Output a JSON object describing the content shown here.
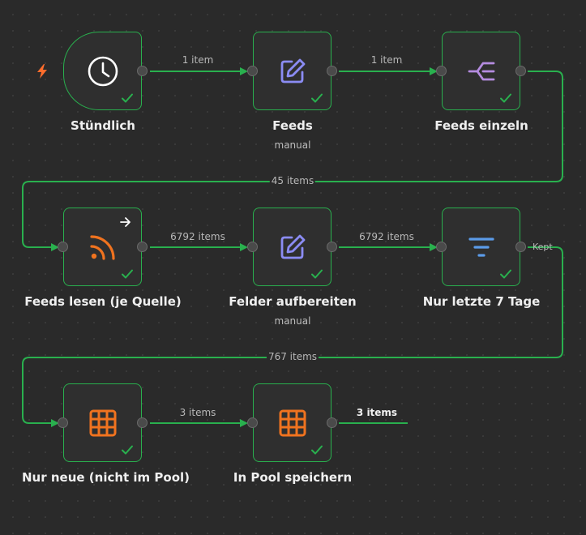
{
  "nodes": {
    "hourly": {
      "label": "Stündlich"
    },
    "feeds": {
      "label": "Feeds",
      "subtitle": "manual"
    },
    "feeds_single": {
      "label": "Feeds einzeln"
    },
    "read_feeds": {
      "label": "Feeds lesen (je Quelle)"
    },
    "prepare_fields": {
      "label": "Felder aufbereiten",
      "subtitle": "manual"
    },
    "last_7_days": {
      "label": "Nur letzte 7 Tage",
      "output_name": "Kept"
    },
    "only_new": {
      "label": "Nur neue (nicht im Pool)"
    },
    "save_pool": {
      "label": "In Pool speichern"
    }
  },
  "edges": {
    "e1": "1 item",
    "e2": "1 item",
    "e3": "45 items",
    "e4": "6792 items",
    "e5": "6792 items",
    "e6": "767 items",
    "e7": "3 items",
    "e8": "3 items"
  },
  "colors": {
    "wire": "#29b04e",
    "node_border": "#29b04e",
    "trigger_bolt": "#ff6d2c",
    "edit_icon": "#8b8cf4",
    "split_icon": "#b58ce0",
    "rss_icon": "#f0731f",
    "filter_icon": "#5b9be8",
    "table_icon": "#f0731f"
  },
  "icons": {
    "hourly": "clock-icon",
    "feeds": "pencil-icon",
    "feeds_single": "split-out-icon",
    "read_feeds": "rss-icon",
    "prepare_fields": "pencil-icon",
    "last_7_days": "filter-icon",
    "only_new": "table-icon",
    "save_pool": "table-icon"
  }
}
